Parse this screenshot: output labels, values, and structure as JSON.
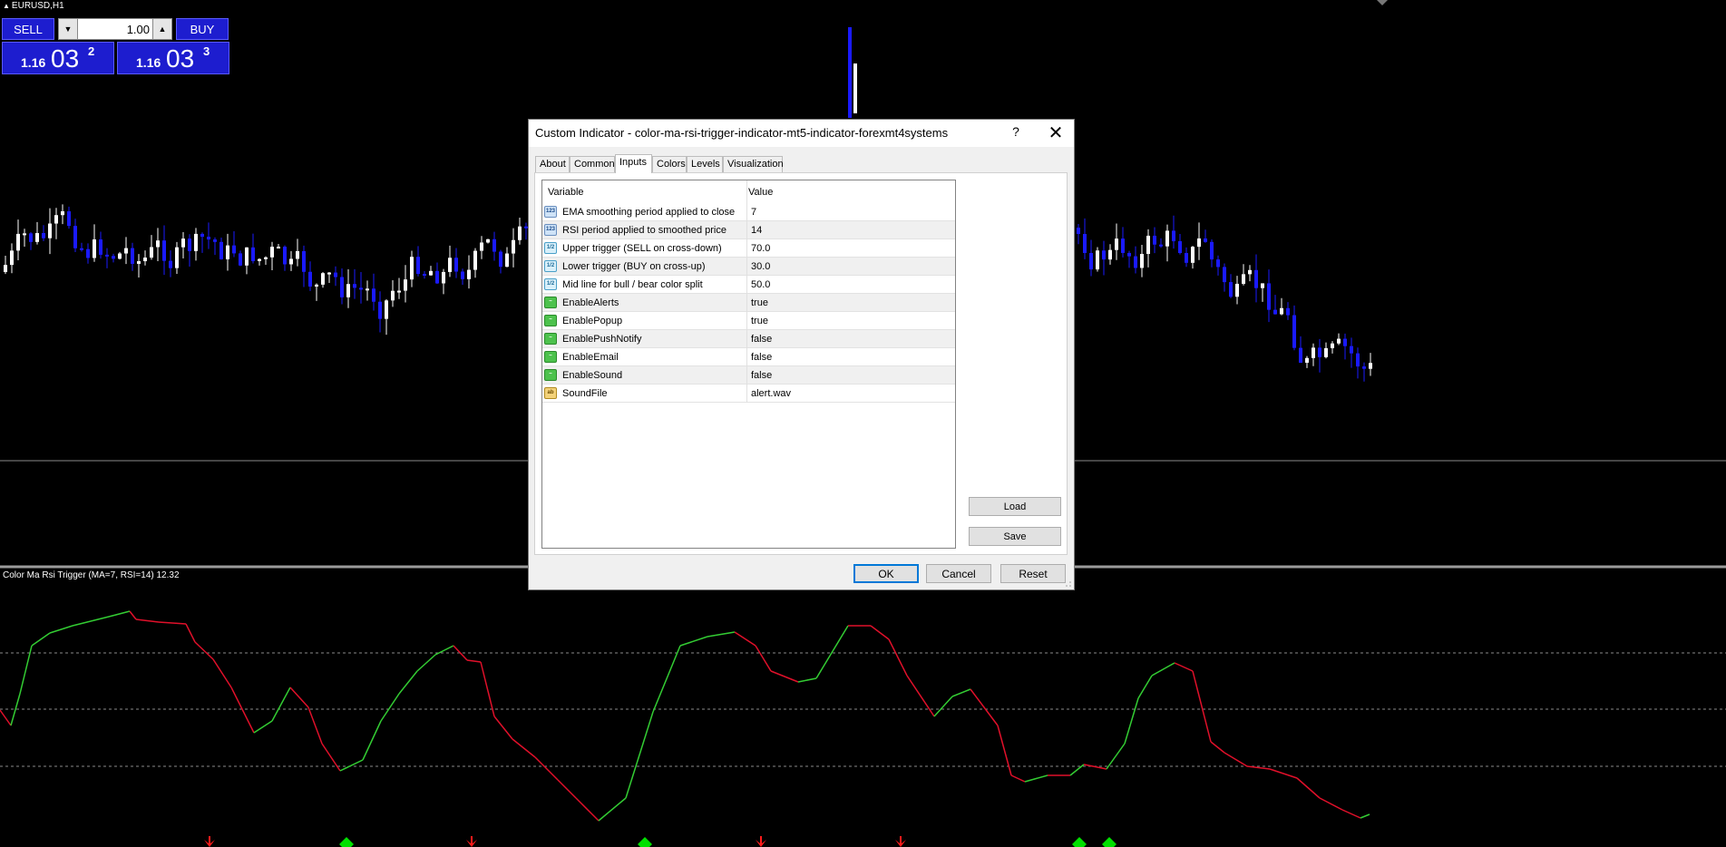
{
  "chart": {
    "symbol": "EURUSD,H1",
    "subwindow_label": "Color Ma Rsi Trigger (MA=7, RSI=14) 12.32",
    "colors": {
      "bull_candle": "#ffffff",
      "bear_candle": "#1a1aff",
      "rsi_up": "#33cc33",
      "rsi_down": "#e0102a",
      "level_line": "#8a8a8a",
      "buy_arrow": "#00e000",
      "sell_arrow": "#ff1a1a"
    }
  },
  "trade_panel": {
    "sell_label": "SELL",
    "buy_label": "BUY",
    "lot_value": "1.00",
    "sell_price": {
      "small": "1.16",
      "big": "03",
      "sup": "2"
    },
    "buy_price": {
      "small": "1.16",
      "big": "03",
      "sup": "3"
    }
  },
  "dialog": {
    "title": "Custom Indicator - color-ma-rsi-trigger-indicator-mt5-indicator-forexmt4systems",
    "help_label": "?",
    "close_label": "✕",
    "tabs": [
      {
        "label": "About",
        "active": false
      },
      {
        "label": "Common",
        "active": false
      },
      {
        "label": "Inputs",
        "active": true
      },
      {
        "label": "Colors",
        "active": false
      },
      {
        "label": "Levels",
        "active": false
      },
      {
        "label": "Visualization",
        "active": false
      }
    ],
    "grid": {
      "col_variable": "Variable",
      "col_value": "Value",
      "rows": [
        {
          "icon": "int-icon",
          "icon_text": "123",
          "name": "EMA smoothing period applied to close",
          "value": "7"
        },
        {
          "icon": "int-icon",
          "icon_text": "123",
          "name": "RSI period applied to smoothed price",
          "value": "14"
        },
        {
          "icon": "double-icon",
          "icon_text": "1/2",
          "name": "Upper trigger (SELL on cross-down)",
          "value": "70.0"
        },
        {
          "icon": "double-icon",
          "icon_text": "1/2",
          "name": "Lower trigger (BUY on cross-up)",
          "value": "30.0"
        },
        {
          "icon": "double-icon",
          "icon_text": "1/2",
          "name": "Mid line for bull / bear color split",
          "value": "50.0"
        },
        {
          "icon": "bool-icon",
          "icon_text": "~",
          "name": "EnableAlerts",
          "value": "true"
        },
        {
          "icon": "bool-icon",
          "icon_text": "~",
          "name": "EnablePopup",
          "value": "true"
        },
        {
          "icon": "bool-icon",
          "icon_text": "~",
          "name": "EnablePushNotify",
          "value": "false"
        },
        {
          "icon": "bool-icon",
          "icon_text": "~",
          "name": "EnableEmail",
          "value": "false"
        },
        {
          "icon": "bool-icon",
          "icon_text": "~",
          "name": "EnableSound",
          "value": "false"
        },
        {
          "icon": "string-icon",
          "icon_text": "ab",
          "name": "SoundFile",
          "value": "alert.wav"
        }
      ]
    },
    "load_label": "Load",
    "save_label": "Save",
    "ok_label": "OK",
    "cancel_label": "Cancel",
    "reset_label": "Reset"
  }
}
